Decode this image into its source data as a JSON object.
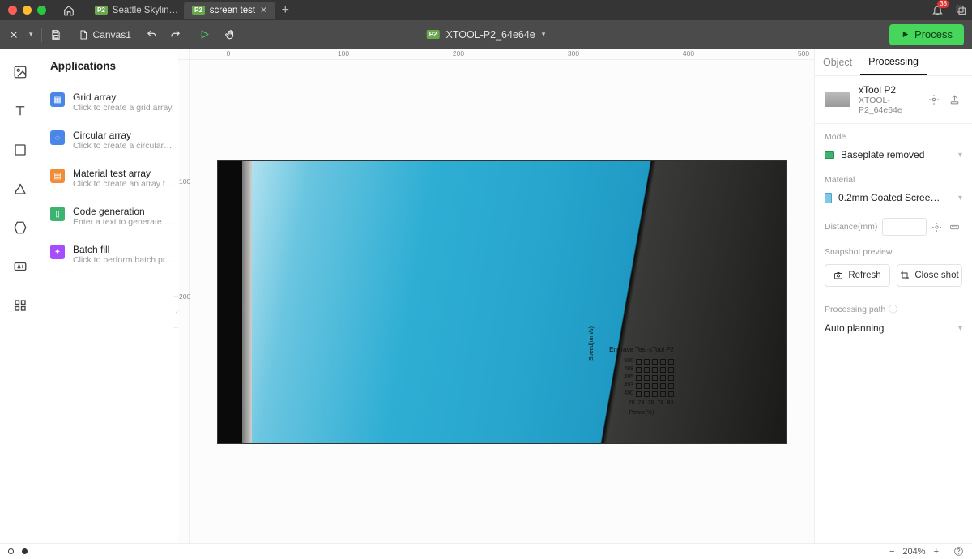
{
  "tabstrip": {
    "tabs": [
      {
        "label": "Seattle Skylin…",
        "badge": "P2"
      },
      {
        "label": "screen test",
        "badge": "P2"
      }
    ],
    "active_index": 1,
    "notification_count": "38"
  },
  "toolbar": {
    "doc_name": "Canvas1",
    "device_name": "XTOOL-P2_64e64e",
    "device_badge": "P2",
    "process_label": "Process"
  },
  "apps": {
    "title": "Applications",
    "items": [
      {
        "title": "Grid array",
        "desc": "Click to create a grid array.",
        "color": "#4a86e8"
      },
      {
        "title": "Circular array",
        "desc": "Click to create a circular arr…",
        "color": "#4a86e8"
      },
      {
        "title": "Material test array",
        "desc": "Click to create an array to t…",
        "color": "#f08c3a"
      },
      {
        "title": "Code generation",
        "desc": "Enter a text to generate a b…",
        "color": "#3cb371"
      },
      {
        "title": "Batch fill",
        "desc": "Click to perform batch proc…",
        "color": "#a64dff"
      }
    ]
  },
  "ruler": {
    "h": [
      "0",
      "100",
      "200",
      "300",
      "400",
      "500"
    ],
    "v": [
      "100",
      "200"
    ]
  },
  "inspector": {
    "tabs": {
      "object": "Object",
      "processing": "Processing"
    },
    "device": {
      "name": "xTool P2",
      "id": "XTOOL-P2_64e64e"
    },
    "mode": {
      "label": "Mode",
      "value": "Baseplate removed"
    },
    "material": {
      "label": "Material",
      "value": "0.2mm Coated Screen (100…"
    },
    "distance": {
      "label": "Distance(mm)",
      "value": ""
    },
    "snapshot": {
      "label": "Snapshot preview",
      "refresh": "Refresh",
      "close": "Close shot"
    },
    "path": {
      "label": "Processing path",
      "value": "Auto planning"
    }
  },
  "engrave_test": {
    "title": "Engrave Test-xTool P2",
    "speed_vals": [
      "500",
      "498",
      "495",
      "493",
      "490"
    ],
    "power_vals": [
      "70",
      "73",
      "75",
      "78",
      "80"
    ],
    "ylabel": "Speed(mm/s)",
    "xlabel": "Power(%)"
  },
  "statusbar": {
    "zoom": "204%"
  }
}
